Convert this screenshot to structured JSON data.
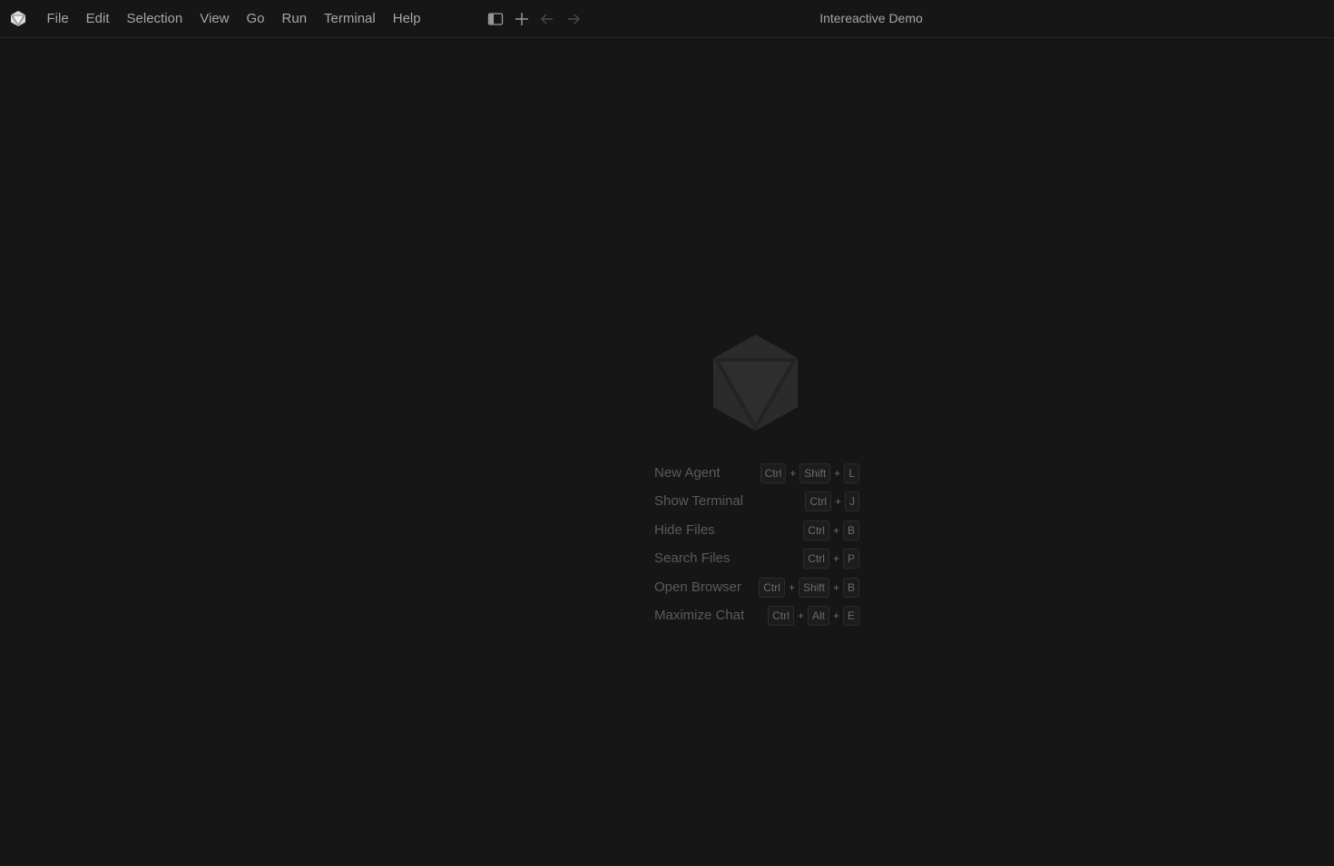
{
  "titlebar": {
    "logo_icon": "cube-logo-icon",
    "menu": [
      "File",
      "Edit",
      "Selection",
      "View",
      "Go",
      "Run",
      "Terminal",
      "Help"
    ],
    "toolbar_icons": [
      "toggle-sidebar-icon",
      "plus-icon",
      "arrow-left-icon",
      "arrow-right-icon"
    ],
    "title": "Intereactive Demo"
  },
  "welcome": {
    "logo_icon": "cube-logo-icon",
    "shortcuts": [
      {
        "label": "New Agent",
        "keys": [
          "Ctrl",
          "Shift",
          "L"
        ]
      },
      {
        "label": "Show Terminal",
        "keys": [
          "Ctrl",
          "J"
        ]
      },
      {
        "label": "Hide Files",
        "keys": [
          "Ctrl",
          "B"
        ]
      },
      {
        "label": "Search Files",
        "keys": [
          "Ctrl",
          "P"
        ]
      },
      {
        "label": "Open Browser",
        "keys": [
          "Ctrl",
          "Shift",
          "B"
        ]
      },
      {
        "label": "Maximize Chat",
        "keys": [
          "Ctrl",
          "Alt",
          "E"
        ]
      }
    ]
  },
  "colors": {
    "background": "#161616",
    "menu_text": "#a6a6a6",
    "muted_text": "#5a5a5a",
    "logo_fill": "#2b2b2b"
  }
}
